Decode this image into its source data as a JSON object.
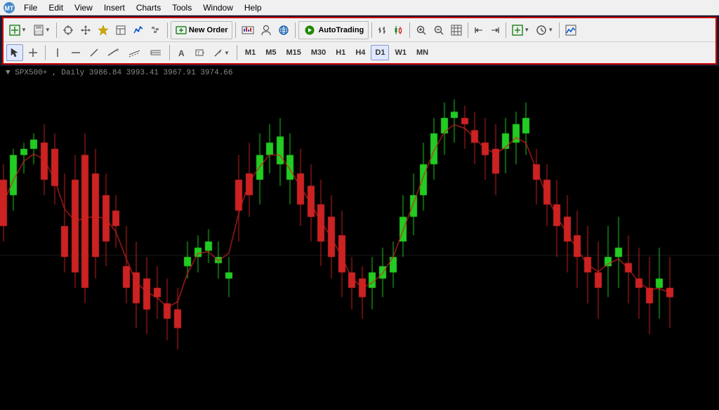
{
  "menubar": {
    "items": [
      "File",
      "Edit",
      "View",
      "Insert",
      "Charts",
      "Tools",
      "Window",
      "Help"
    ]
  },
  "toolbar": {
    "new_order_label": "New Order",
    "autotrading_label": "AutoTrading",
    "timeframes": [
      "M1",
      "M5",
      "M15",
      "M30",
      "H1",
      "H4",
      "D1",
      "W1",
      "MN"
    ],
    "active_timeframe": "D1"
  },
  "chart": {
    "symbol": "SPX500+",
    "timeframe": "Daily",
    "values": "3986.84 3993.41 3967.91 3974.66"
  },
  "colors": {
    "bull_candle": "#22cc22",
    "bear_candle": "#cc2222",
    "background": "#000000",
    "grid_line": "#1a1a1a",
    "ma_line": "#cc2222",
    "crosshair": "#444444"
  }
}
